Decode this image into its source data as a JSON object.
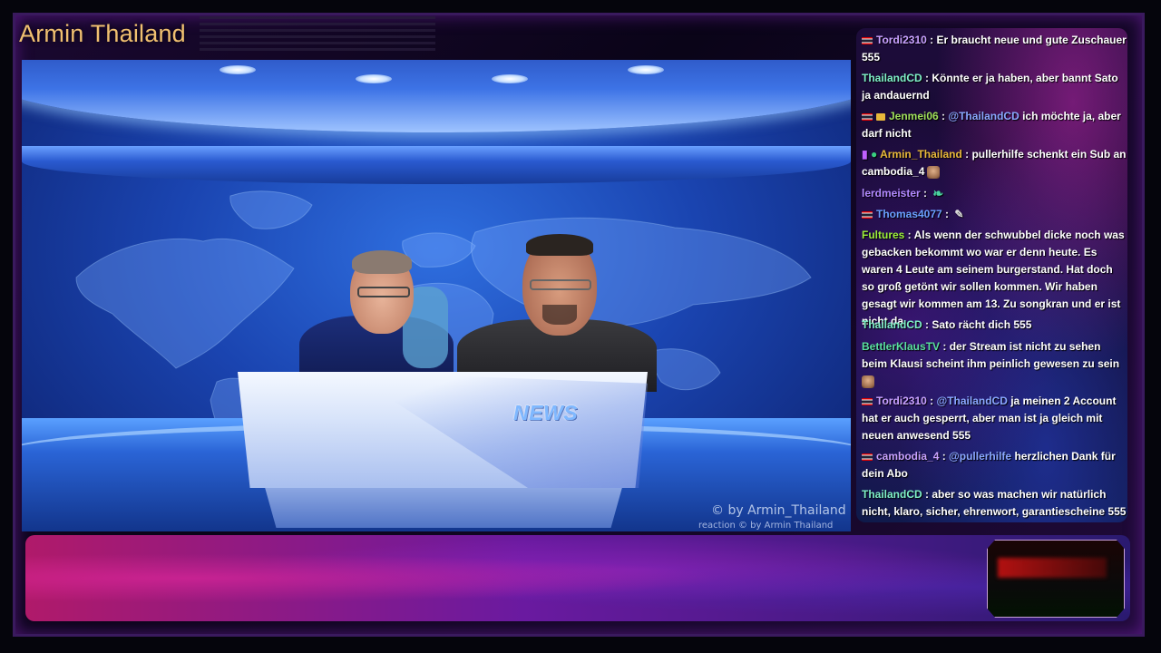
{
  "channel": {
    "title": "Armin Thailand"
  },
  "video": {
    "desk_label": "NEWS",
    "watermark": "© by Armin_Thailand",
    "watermark_small": "reaction © by Armin Thailand"
  },
  "chat": {
    "messages": [
      {
        "user": "Tordi2310",
        "user_color": "#c9a2ff",
        "badge": "flag-th",
        "text": "Er braucht neue und gute Zuschauer 555"
      },
      {
        "user": "ThailandCD",
        "user_color": "#7ff0c8",
        "badge": "",
        "text": "Könnte er ja haben, aber bannt Sato ja andauernd"
      },
      {
        "user": "Jenmei06",
        "user_color": "#9fe05a",
        "badge": "flag-th",
        "mention": "@ThailandCD",
        "text": "ich möchte ja, aber darf nicht"
      },
      {
        "user": "Armin_Thailand",
        "user_color": "#e8b83a",
        "badge": "mod",
        "text": "pullerhilfe schenkt ein Sub an cambodia_4",
        "emote": "emo-face"
      },
      {
        "user": "lerdmeister",
        "user_color": "#b28aff",
        "badge": "",
        "text": "",
        "emote": "emo-feather"
      },
      {
        "user": "Thomas4077",
        "user_color": "#6aa0ff",
        "badge": "flag-th",
        "text": "",
        "emote": "emo-dot"
      },
      {
        "user": "Fultures",
        "user_color": "#9cf03a",
        "badge": "",
        "text": "Als wenn der schwubbel dicke noch was gebacken bekommt wo war er denn heute. Es waren 4 Leute am seinem burgerstand. Hat doch so groß getönt wir sollen kommen. Wir haben gesagt wir kommen am 13. Zu songkran und er ist nicht da"
      },
      {
        "user": "ThailandCD",
        "user_color": "#7ff0c8",
        "badge": "",
        "text": "Sato rächt dich 555"
      },
      {
        "user": "BettlerKlausTV",
        "user_color": "#5ae0a0",
        "badge": "",
        "text": "der Stream ist nicht zu sehen beim Klausi scheint ihm peinlich gewesen zu sein"
      },
      {
        "user": "Tordi2310",
        "user_color": "#c9a2ff",
        "badge": "flag-th",
        "mention": "@ThailandCD",
        "text": "ja meinen 2 Account hat er auch gesperrt, aber man ist ja gleich mit neuen anwesend 555"
      },
      {
        "user": "cambodia_4",
        "user_color": "#c9a2ff",
        "badge": "flag-th",
        "mention": "@pullerhilfe",
        "text": "herzlichen Dank für dein Abo"
      },
      {
        "user": "ThailandCD",
        "user_color": "#7ff0c8",
        "badge": "",
        "text": "aber so was machen wir natürlich nicht, klaro, sicher, ehrenwort, garantiescheine 555"
      }
    ]
  }
}
